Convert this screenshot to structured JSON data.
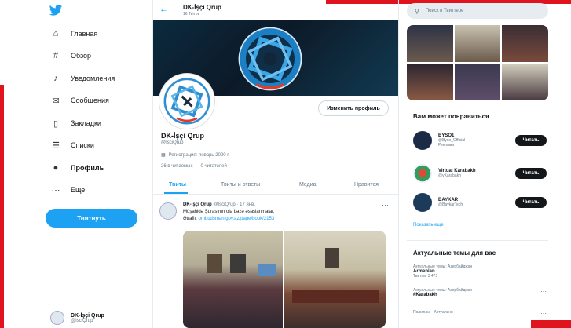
{
  "colors": {
    "accent": "#1da1f2",
    "red_marks": "#e0141e",
    "dark_button": "#14171a"
  },
  "sidebar": {
    "logo": "twitter-icon",
    "items": [
      {
        "label": "Главная",
        "icon": "home-icon"
      },
      {
        "label": "Обзор",
        "icon": "hash-icon"
      },
      {
        "label": "Уведомления",
        "icon": "bell-icon"
      },
      {
        "label": "Сообщения",
        "icon": "mail-icon"
      },
      {
        "label": "Закладки",
        "icon": "bookmark-icon"
      },
      {
        "label": "Списки",
        "icon": "list-icon"
      },
      {
        "label": "Профиль",
        "icon": "person-icon"
      },
      {
        "label": "Еще",
        "icon": "more-icon"
      }
    ],
    "tweet_button": "Твитнуть",
    "account": {
      "name": "DK-İşçi Qrup",
      "handle": "@IsciQrup"
    }
  },
  "header": {
    "title": "DK-İşçi Qrup",
    "subtitle": "16 Твітов"
  },
  "profile": {
    "edit_button": "Изменить профиль",
    "name": "DK-İşçi Qrup",
    "handle": "@IsciQrup",
    "joined": "Регистрация: январь 2020 г.",
    "following": "26 в читаемых",
    "followers": "0 читателей"
  },
  "tabs": [
    "Твиты",
    "Твиты и ответы",
    "Медиа",
    "Нравится"
  ],
  "tweet": {
    "name": "DK-İşçi Qrup",
    "meta": "@IsciQrup · 17 янв.",
    "line1": "Müşahidə Şurasının ola bəzə əsaslanmalar,",
    "line2": "Ətraflı:",
    "link": "ombudsman.gov.az/page/book/2153"
  },
  "right": {
    "search_placeholder": "Поиск в Твиттере",
    "who_to_follow_title": "Вам может понравиться",
    "suggestions": [
      {
        "name": "BYSO1",
        "handle": "@Byso_Official",
        "extra": "Рекламa",
        "follow": "Читать"
      },
      {
        "name": "Virtual Karabakh",
        "handle": "@vKarabakh",
        "extra": "",
        "follow": "Читать"
      },
      {
        "name": "BAYKAR",
        "handle": "@BaykarTech",
        "extra": "",
        "follow": "Читать"
      }
    ],
    "show_more": "Показать еще",
    "trends_title": "Актуальные темы для вас",
    "trends": [
      {
        "label": "Актуальные темы: Азербайджан",
        "name": "Armenian",
        "count": "Твитов: 3 473"
      },
      {
        "label": "Актуальные темы: Азербайджан",
        "name": "#Karabakh",
        "count": ""
      },
      {
        "label": "Политика · Актуально",
        "name": "",
        "count": ""
      }
    ]
  }
}
